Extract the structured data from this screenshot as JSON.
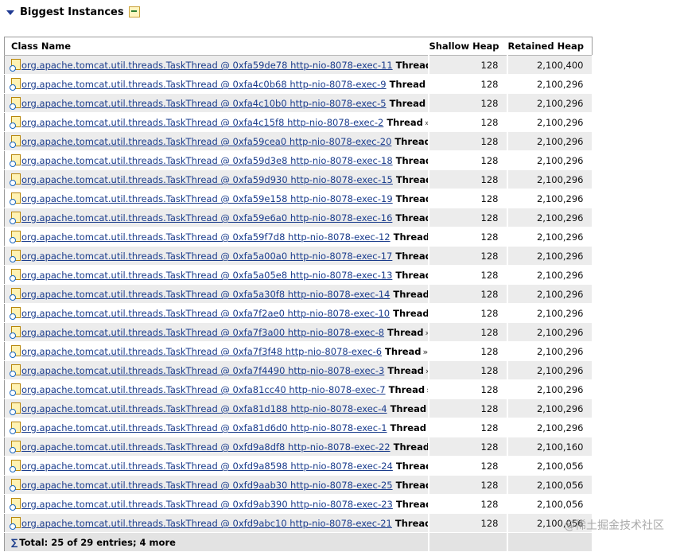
{
  "section": {
    "title": "Biggest Instances"
  },
  "table": {
    "headers": {
      "class_name": "Class Name",
      "shallow_heap": "Shallow Heap",
      "retained_heap": "Retained Heap"
    },
    "thread_label": "Thread",
    "more_glyph": "»",
    "rows": [
      {
        "obj": "org.apache.tomcat.util.threads.TaskThread @ 0xfa59de78 http-nio-8078-exec-11",
        "shallow": "128",
        "retained": "2,100,400"
      },
      {
        "obj": "org.apache.tomcat.util.threads.TaskThread @ 0xfa4c0b68 http-nio-8078-exec-9",
        "shallow": "128",
        "retained": "2,100,296"
      },
      {
        "obj": "org.apache.tomcat.util.threads.TaskThread @ 0xfa4c10b0 http-nio-8078-exec-5",
        "shallow": "128",
        "retained": "2,100,296"
      },
      {
        "obj": "org.apache.tomcat.util.threads.TaskThread @ 0xfa4c15f8 http-nio-8078-exec-2",
        "shallow": "128",
        "retained": "2,100,296"
      },
      {
        "obj": "org.apache.tomcat.util.threads.TaskThread @ 0xfa59cea0 http-nio-8078-exec-20",
        "shallow": "128",
        "retained": "2,100,296"
      },
      {
        "obj": "org.apache.tomcat.util.threads.TaskThread @ 0xfa59d3e8 http-nio-8078-exec-18",
        "shallow": "128",
        "retained": "2,100,296"
      },
      {
        "obj": "org.apache.tomcat.util.threads.TaskThread @ 0xfa59d930 http-nio-8078-exec-15",
        "shallow": "128",
        "retained": "2,100,296"
      },
      {
        "obj": "org.apache.tomcat.util.threads.TaskThread @ 0xfa59e158 http-nio-8078-exec-19",
        "shallow": "128",
        "retained": "2,100,296"
      },
      {
        "obj": "org.apache.tomcat.util.threads.TaskThread @ 0xfa59e6a0 http-nio-8078-exec-16",
        "shallow": "128",
        "retained": "2,100,296"
      },
      {
        "obj": "org.apache.tomcat.util.threads.TaskThread @ 0xfa59f7d8 http-nio-8078-exec-12",
        "shallow": "128",
        "retained": "2,100,296"
      },
      {
        "obj": "org.apache.tomcat.util.threads.TaskThread @ 0xfa5a00a0 http-nio-8078-exec-17",
        "shallow": "128",
        "retained": "2,100,296"
      },
      {
        "obj": "org.apache.tomcat.util.threads.TaskThread @ 0xfa5a05e8 http-nio-8078-exec-13",
        "shallow": "128",
        "retained": "2,100,296"
      },
      {
        "obj": "org.apache.tomcat.util.threads.TaskThread @ 0xfa5a30f8 http-nio-8078-exec-14",
        "shallow": "128",
        "retained": "2,100,296"
      },
      {
        "obj": "org.apache.tomcat.util.threads.TaskThread @ 0xfa7f2ae0 http-nio-8078-exec-10",
        "shallow": "128",
        "retained": "2,100,296"
      },
      {
        "obj": "org.apache.tomcat.util.threads.TaskThread @ 0xfa7f3a00 http-nio-8078-exec-8",
        "shallow": "128",
        "retained": "2,100,296"
      },
      {
        "obj": "org.apache.tomcat.util.threads.TaskThread @ 0xfa7f3f48 http-nio-8078-exec-6",
        "shallow": "128",
        "retained": "2,100,296"
      },
      {
        "obj": "org.apache.tomcat.util.threads.TaskThread @ 0xfa7f4490 http-nio-8078-exec-3",
        "shallow": "128",
        "retained": "2,100,296"
      },
      {
        "obj": "org.apache.tomcat.util.threads.TaskThread @ 0xfa81cc40 http-nio-8078-exec-7",
        "shallow": "128",
        "retained": "2,100,296"
      },
      {
        "obj": "org.apache.tomcat.util.threads.TaskThread @ 0xfa81d188 http-nio-8078-exec-4",
        "shallow": "128",
        "retained": "2,100,296"
      },
      {
        "obj": "org.apache.tomcat.util.threads.TaskThread @ 0xfa81d6d0 http-nio-8078-exec-1",
        "shallow": "128",
        "retained": "2,100,296"
      },
      {
        "obj": "org.apache.tomcat.util.threads.TaskThread @ 0xfd9a8df8 http-nio-8078-exec-22",
        "shallow": "128",
        "retained": "2,100,160"
      },
      {
        "obj": "org.apache.tomcat.util.threads.TaskThread @ 0xfd9a8598 http-nio-8078-exec-24",
        "shallow": "128",
        "retained": "2,100,056"
      },
      {
        "obj": "org.apache.tomcat.util.threads.TaskThread @ 0xfd9aab30 http-nio-8078-exec-25",
        "shallow": "128",
        "retained": "2,100,056"
      },
      {
        "obj": "org.apache.tomcat.util.threads.TaskThread @ 0xfd9ab390 http-nio-8078-exec-23",
        "shallow": "128",
        "retained": "2,100,056"
      },
      {
        "obj": "org.apache.tomcat.util.threads.TaskThread @ 0xfd9abc10 http-nio-8078-exec-21",
        "shallow": "128",
        "retained": "2,100,056"
      }
    ],
    "total_label": "Total: 25 of 29 entries; 4 more"
  },
  "watermark": "@稀土掘金技术社区"
}
